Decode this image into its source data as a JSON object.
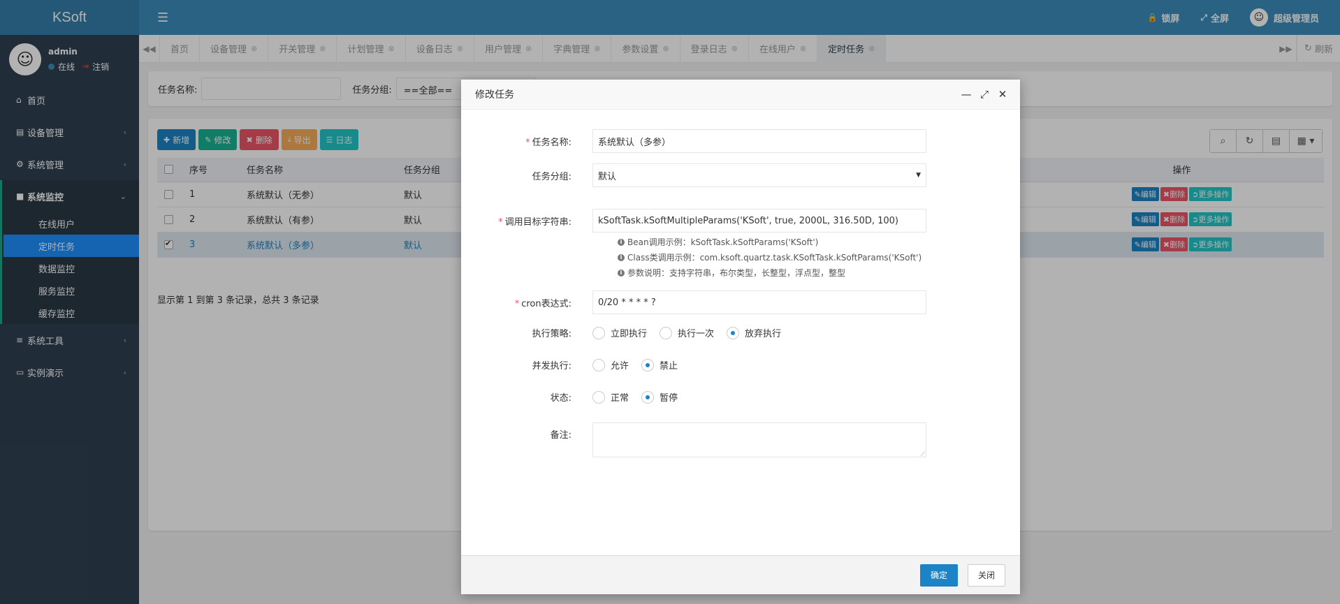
{
  "app": {
    "brand": "KSoft"
  },
  "topbar": {
    "lock_label": "锁屏",
    "fullscreen_label": "全屏",
    "user_label": "超级管理员"
  },
  "sidebar": {
    "user": {
      "name": "admin",
      "status": "在线",
      "logout": "注销"
    },
    "items": [
      {
        "label": "首页"
      },
      {
        "label": "设备管理"
      },
      {
        "label": "系统管理"
      },
      {
        "label": "系统监控"
      },
      {
        "label": "系统工具"
      },
      {
        "label": "实例演示"
      }
    ],
    "subitems": [
      {
        "label": "在线用户"
      },
      {
        "label": "定时任务"
      },
      {
        "label": "数据监控"
      },
      {
        "label": "服务监控"
      },
      {
        "label": "缓存监控"
      }
    ]
  },
  "tabs": [
    {
      "label": "首页"
    },
    {
      "label": "设备管理"
    },
    {
      "label": "开关管理"
    },
    {
      "label": "计划管理"
    },
    {
      "label": "设备日志"
    },
    {
      "label": "用户管理"
    },
    {
      "label": "字典管理"
    },
    {
      "label": "参数设置"
    },
    {
      "label": "登录日志"
    },
    {
      "label": "在线用户"
    },
    {
      "label": "定时任务"
    }
  ],
  "tabs_refresh": "刷新",
  "search": {
    "name_label": "任务名称:",
    "group_label": "任务分组:",
    "group_value": "==全部=="
  },
  "toolbar": {
    "add": "新增",
    "edit": "修改",
    "delete": "删除",
    "export": "导出",
    "log": "日志"
  },
  "table": {
    "headers": {
      "seq": "序号",
      "name": "任务名称",
      "group": "任务分组",
      "ops": "操作"
    },
    "rows": [
      {
        "seq": "1",
        "name": "系统默认（无参）",
        "group": "默认"
      },
      {
        "seq": "2",
        "name": "系统默认（有参）",
        "group": "默认"
      },
      {
        "seq": "3",
        "name": "系统默认（多参）",
        "group": "默认"
      }
    ],
    "op_edit": "编辑",
    "op_delete": "删除",
    "op_more": "更多操作",
    "footer": "显示第 1 到第 3 条记录，总共 3 条记录"
  },
  "modal": {
    "title": "修改任务",
    "fields": {
      "job_name": {
        "label": "任务名称:",
        "value": "系统默认（多参）"
      },
      "job_group": {
        "label": "任务分组:",
        "value": "默认"
      },
      "invoke_target": {
        "label": "调用目标字符串:",
        "value": "kSoftTask.kSoftMultipleParams('KSoft', true, 2000L, 316.50D, 100)"
      },
      "cron": {
        "label": "cron表达式:",
        "value": "0/20 * * * * ?"
      },
      "misfire": {
        "label": "执行策略:",
        "options": [
          "立即执行",
          "执行一次",
          "放弃执行"
        ],
        "selected": "放弃执行"
      },
      "concurrent": {
        "label": "并发执行:",
        "options": [
          "允许",
          "禁止"
        ],
        "selected": "禁止"
      },
      "status": {
        "label": "状态:",
        "options": [
          "正常",
          "暂停"
        ],
        "selected": "暂停"
      },
      "remark": {
        "label": "备注:",
        "value": ""
      }
    },
    "hints": {
      "bean": "Bean调用示例：kSoftTask.kSoftParams('KSoft')",
      "class": "Class类调用示例：com.ksoft.quartz.task.KSoftTask.kSoftParams('KSoft')",
      "params": "参数说明：支持字符串，布尔类型，长整型，浮点型，整型"
    },
    "ok": "确定",
    "close": "关闭"
  },
  "colors": {
    "topbar": "#3c8dbc",
    "sidebar": "#2f4050",
    "active_sub": "#1e90ff",
    "primary": "#1c84c6",
    "danger": "#ed5565"
  }
}
